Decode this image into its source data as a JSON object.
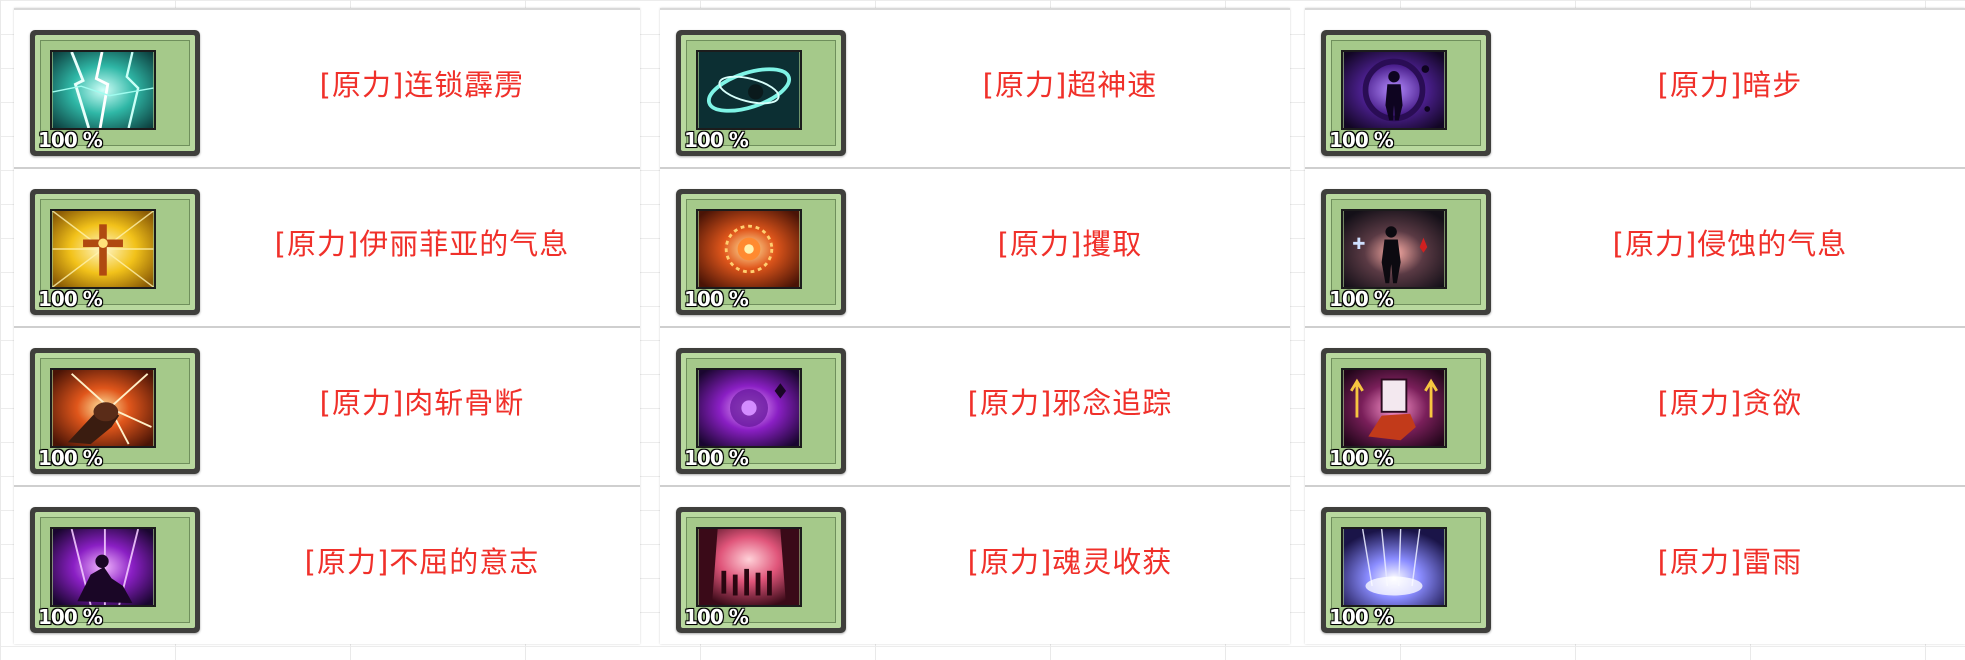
{
  "colors": {
    "label": "#f0302a",
    "frame_outer": "#3f3f3c",
    "frame_ring": "#b9d99f"
  },
  "panels": [
    {
      "items": [
        {
          "label": "[原力]连锁霹雳",
          "percent": "100 %",
          "icon": "lightning-chain-icon"
        },
        {
          "label": "[原力]伊丽菲亚的气息",
          "percent": "100 %",
          "icon": "holy-cross-icon"
        },
        {
          "label": "[原力]肉斩骨断",
          "percent": "100 %",
          "icon": "fist-strike-icon"
        },
        {
          "label": "[原力]不屈的意志",
          "percent": "100 %",
          "icon": "indomitable-will-icon"
        }
      ]
    },
    {
      "items": [
        {
          "label": "[原力]超神速",
          "percent": "100 %",
          "icon": "super-speed-icon"
        },
        {
          "label": "[原力]攫取",
          "percent": "100 %",
          "icon": "seize-icon"
        },
        {
          "label": "[原力]邪念追踪",
          "percent": "100 %",
          "icon": "evil-tracking-icon"
        },
        {
          "label": "[原力]魂灵收获",
          "percent": "100 %",
          "icon": "soul-harvest-icon"
        }
      ]
    },
    {
      "items": [
        {
          "label": "[原力]暗步",
          "percent": "100 %",
          "icon": "dark-step-icon"
        },
        {
          "label": "[原力]侵蚀的气息",
          "percent": "100 %",
          "icon": "erosion-breath-icon"
        },
        {
          "label": "[原力]贪欲",
          "percent": "100 %",
          "icon": "greed-icon"
        },
        {
          "label": "[原力]雷雨",
          "percent": "100 %",
          "icon": "thunder-rain-icon"
        }
      ]
    }
  ]
}
